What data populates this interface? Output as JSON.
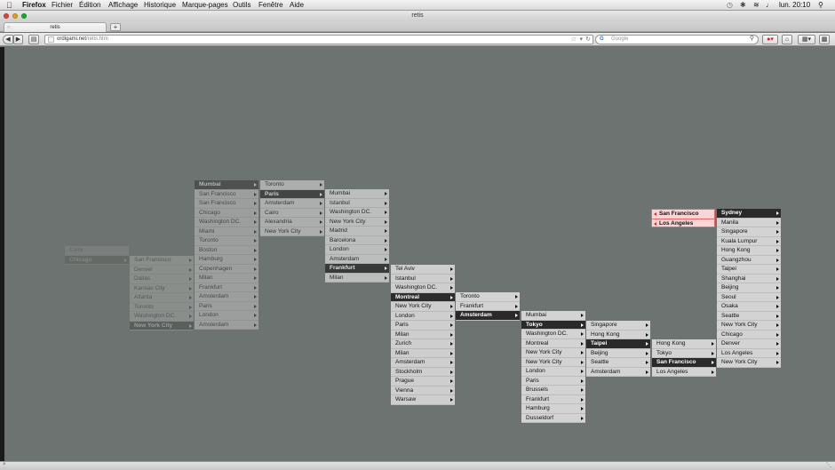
{
  "menubar": {
    "app": "Firefox",
    "items": [
      "Fichier",
      "Édition",
      "Affichage",
      "Historique",
      "Marque-pages",
      "Outils",
      "Fenêtre",
      "Aide"
    ],
    "clock": "lun. 20:10"
  },
  "window": {
    "title": "retis"
  },
  "tab": {
    "label": "retis",
    "new_tab": "+"
  },
  "navbar": {
    "url_domain": "ordigami.net",
    "url_path": "/retis.htm",
    "search_engine_glyph": "G",
    "search_placeholder": "Google"
  },
  "columns": [
    {
      "id": "c0",
      "items": [
        {
          "label": "Cairo"
        },
        {
          "label": "Chicago",
          "hi": true
        }
      ],
      "opacity": 0.13
    },
    {
      "id": "c1",
      "items": [
        {
          "label": "San Francisco",
          "arrow": true
        },
        {
          "label": "Denver",
          "arrow": true
        },
        {
          "label": "Dallas",
          "arrow": true
        },
        {
          "label": "Kansas City",
          "arrow": true
        },
        {
          "label": "Atlanta",
          "arrow": true
        },
        {
          "label": "Toronto",
          "arrow": true
        },
        {
          "label": "Washington DC.",
          "arrow": true
        },
        {
          "label": "New York City",
          "hi": true
        }
      ],
      "opacity": 0.28
    },
    {
      "id": "c2",
      "items": [
        {
          "label": "Mumbai",
          "hi": true
        },
        {
          "label": "San Francisco",
          "arrow": true
        },
        {
          "label": "San Francisco",
          "arrow": true
        },
        {
          "label": "Chicago",
          "arrow": true
        },
        {
          "label": "Washington DC.",
          "arrow": true
        },
        {
          "label": "Miami",
          "arrow": true
        },
        {
          "label": "Toronto",
          "arrow": true
        },
        {
          "label": "Boston",
          "arrow": true
        },
        {
          "label": "Hamburg",
          "arrow": true
        },
        {
          "label": "Copenhagen",
          "arrow": true
        },
        {
          "label": "Milan",
          "arrow": true
        },
        {
          "label": "Frankfurt",
          "arrow": true
        },
        {
          "label": "Amsterdam",
          "arrow": true
        },
        {
          "label": "Paris",
          "arrow": true
        },
        {
          "label": "London",
          "arrow": true
        },
        {
          "label": "Amsterdam",
          "arrow": true
        }
      ],
      "opacity": 0.45
    },
    {
      "id": "c3",
      "items": [
        {
          "label": "Toronto",
          "arrow": true
        },
        {
          "label": "Paris",
          "hi": true
        },
        {
          "label": "Amsterdam",
          "arrow": true
        },
        {
          "label": "Cairo",
          "arrow": true
        },
        {
          "label": "Alexandria",
          "arrow": true
        },
        {
          "label": "New York City",
          "arrow": true
        }
      ],
      "opacity": 0.62
    },
    {
      "id": "c4",
      "items": [
        {
          "label": "Mumbai",
          "arrow": true
        },
        {
          "label": "Istanbul",
          "arrow": true
        },
        {
          "label": "Washington DC.",
          "arrow": true
        },
        {
          "label": "New York City",
          "arrow": true
        },
        {
          "label": "Madrid",
          "arrow": true
        },
        {
          "label": "Barcelona",
          "arrow": true
        },
        {
          "label": "London",
          "arrow": true
        },
        {
          "label": "Amsterdam",
          "arrow": true
        },
        {
          "label": "Frankfurt",
          "hi": true
        },
        {
          "label": "Milan",
          "arrow": true
        }
      ],
      "opacity": 0.78
    },
    {
      "id": "c5",
      "items": [
        {
          "label": "Tel Aviv",
          "arrow": true
        },
        {
          "label": "Istanbul",
          "arrow": true
        },
        {
          "label": "Washington DC.",
          "arrow": true
        },
        {
          "label": "Montreal",
          "hi": true
        },
        {
          "label": "New York City",
          "arrow": true
        },
        {
          "label": "London",
          "arrow": true
        },
        {
          "label": "Paris",
          "arrow": true
        },
        {
          "label": "Milan",
          "arrow": true
        },
        {
          "label": "Zurich",
          "arrow": true
        },
        {
          "label": "Milan",
          "arrow": true
        },
        {
          "label": "Amsterdam",
          "arrow": true
        },
        {
          "label": "Stockholm",
          "arrow": true
        },
        {
          "label": "Prague",
          "arrow": true
        },
        {
          "label": "Vienna",
          "arrow": true
        },
        {
          "label": "Warsaw",
          "arrow": true
        }
      ],
      "opacity": 0.95
    },
    {
      "id": "c6",
      "items": [
        {
          "label": "Toronto",
          "arrow": true
        },
        {
          "label": "Frankfurt",
          "arrow": true
        },
        {
          "label": "Amsterdam",
          "hi": true
        }
      ],
      "opacity": 1
    },
    {
      "id": "c7",
      "items": [
        {
          "label": "Mumbai",
          "arrow": true
        },
        {
          "label": "Tokyo",
          "hi": true
        },
        {
          "label": "Washington DC.",
          "arrow": true
        },
        {
          "label": "Montreal",
          "arrow": true
        },
        {
          "label": "New York City",
          "arrow": true
        },
        {
          "label": "New York City",
          "arrow": true
        },
        {
          "label": "London",
          "arrow": true
        },
        {
          "label": "Paris",
          "arrow": true
        },
        {
          "label": "Brussels",
          "arrow": true
        },
        {
          "label": "Frankfurt",
          "arrow": true
        },
        {
          "label": "Hamburg",
          "arrow": true
        },
        {
          "label": "Dusseldorf",
          "arrow": true
        }
      ],
      "opacity": 1
    },
    {
      "id": "c8",
      "items": [
        {
          "label": "Singapore",
          "arrow": true
        },
        {
          "label": "Hong Kong",
          "arrow": true
        },
        {
          "label": "Taipei",
          "hi": true
        },
        {
          "label": "Beijing",
          "arrow": true
        },
        {
          "label": "Seattle",
          "arrow": true
        },
        {
          "label": "Amsterdam",
          "arrow": true
        }
      ],
      "opacity": 1
    },
    {
      "id": "c9",
      "items": [
        {
          "label": "Hong Kong",
          "arrow": true
        },
        {
          "label": "Tokyo",
          "arrow": true
        },
        {
          "label": "San Francisco",
          "hi": true
        },
        {
          "label": "Los Angeles",
          "arrow": true
        }
      ],
      "opacity": 1
    },
    {
      "id": "c10",
      "items": [
        {
          "label": "San Francisco",
          "pink": true
        },
        {
          "label": "Los Angeles",
          "pink": true
        }
      ],
      "opacity": 1
    },
    {
      "id": "c11",
      "items": [
        {
          "label": "Sydney",
          "hi": true
        },
        {
          "label": "Manila",
          "arrow": true
        },
        {
          "label": "Singapore",
          "arrow": true
        },
        {
          "label": "Kuala Lumpur",
          "arrow": true
        },
        {
          "label": "Hong Kong",
          "arrow": true
        },
        {
          "label": "Guangzhou",
          "arrow": true
        },
        {
          "label": "Taipei",
          "arrow": true
        },
        {
          "label": "Shanghai",
          "arrow": true
        },
        {
          "label": "Beijing",
          "arrow": true
        },
        {
          "label": "Seoul",
          "arrow": true
        },
        {
          "label": "Osaka",
          "arrow": true
        },
        {
          "label": "Seattle",
          "arrow": true
        },
        {
          "label": "New York City",
          "arrow": true
        },
        {
          "label": "Chicago",
          "arrow": true
        },
        {
          "label": "Denver",
          "arrow": true
        },
        {
          "label": "Los Angeles",
          "arrow": true
        },
        {
          "label": "New York City",
          "arrow": true
        }
      ],
      "opacity": 1
    }
  ]
}
